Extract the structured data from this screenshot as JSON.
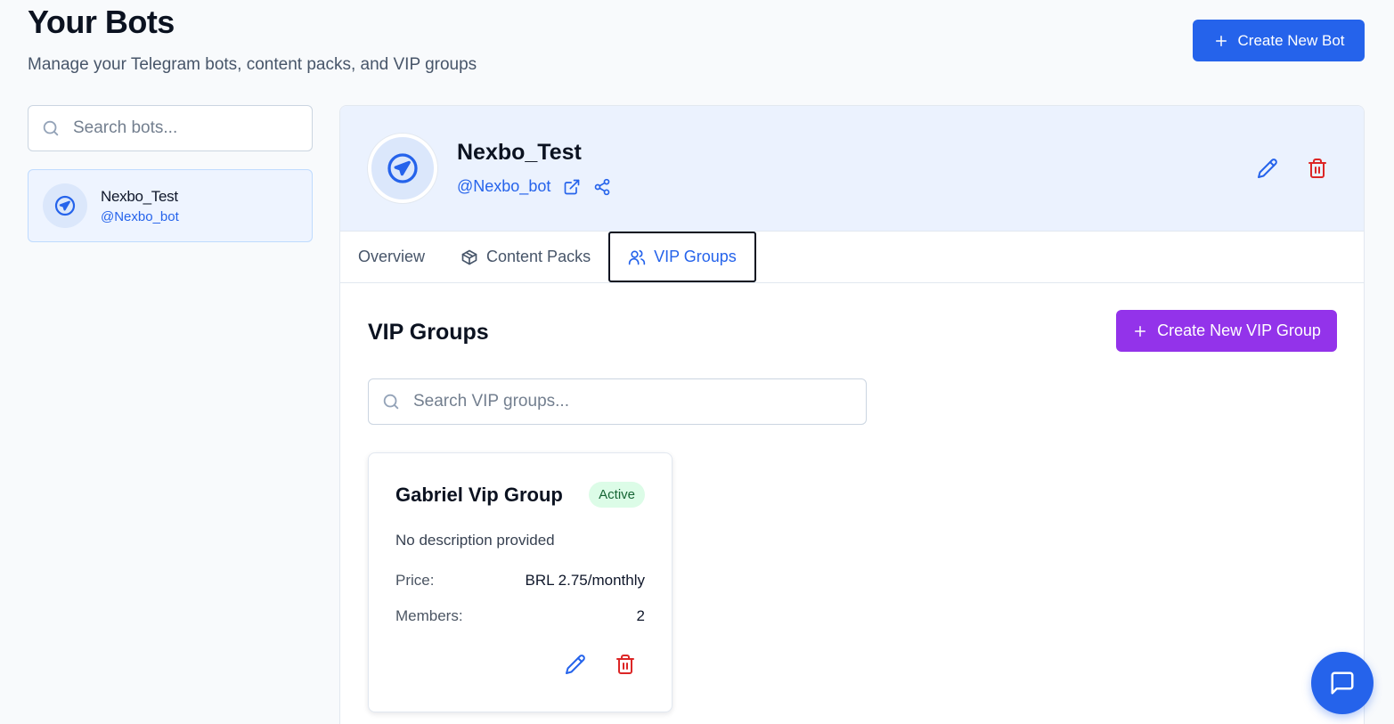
{
  "page": {
    "title": "Your Bots",
    "subtitle": "Manage your Telegram bots, content packs, and VIP groups",
    "create_bot_label": "Create New Bot"
  },
  "sidebar": {
    "search_placeholder": "Search bots...",
    "bots": [
      {
        "name": "Nexbo_Test",
        "handle": "@Nexbo_bot",
        "icon": "telegram-icon"
      }
    ]
  },
  "bot_detail": {
    "name": "Nexbo_Test",
    "handle": "@Nexbo_bot",
    "icon": "telegram-icon",
    "tabs": [
      {
        "label": "Overview",
        "icon": null,
        "active": false
      },
      {
        "label": "Content Packs",
        "icon": "package-icon",
        "active": false
      },
      {
        "label": "VIP Groups",
        "icon": "users-icon",
        "active": true
      }
    ]
  },
  "vip_section": {
    "title": "VIP Groups",
    "create_label": "Create New VIP Group",
    "search_placeholder": "Search VIP groups...",
    "groups": [
      {
        "name": "Gabriel Vip Group",
        "status": "Active",
        "description": "No description provided",
        "price_label": "Price:",
        "price": "BRL 2.75/monthly",
        "members_label": "Members:",
        "members": "2"
      }
    ]
  },
  "colors": {
    "primary": "#2563eb",
    "purple": "#9333ea",
    "danger": "#dc2626",
    "active_badge_bg": "#dcfce7",
    "active_badge_text": "#166534"
  }
}
